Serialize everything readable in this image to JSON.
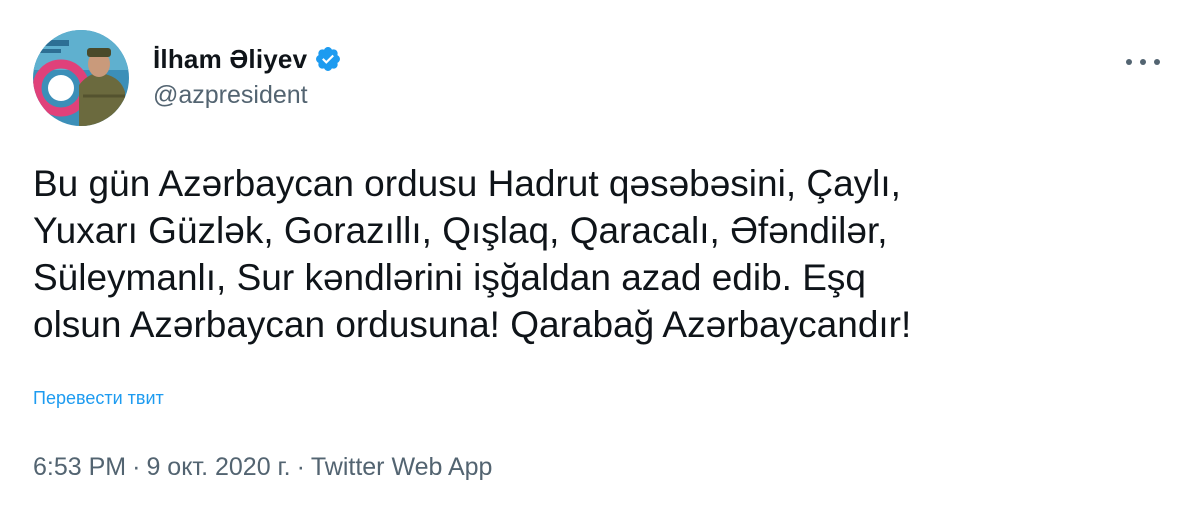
{
  "tweet": {
    "author": {
      "display_name": "İlham Əliyev",
      "handle": "@azpresident",
      "verified": true,
      "avatar_icon": "profile-photo-icon",
      "verified_icon": "verified-badge-icon"
    },
    "more_icon": "more-options-icon",
    "text_lines": [
      "Bu gün Azərbaycan ordusu Hadrut qəsəbəsini, Çaylı,",
      "Yuxarı Güzlək, Gorazıllı, Qışlaq, Qaracalı, Əfəndilər,",
      "Süleymanlı, Sur kəndlərini işğaldan azad edib. Eşq",
      "olsun Azərbaycan ordusuna! Qarabağ Azərbaycandır!"
    ],
    "translate_link": "Перевести твит",
    "time": "6:53 PM",
    "date": "9 окт. 2020 г.",
    "separator": "·",
    "source": "Twitter Web App"
  },
  "colors": {
    "text": "#0f1419",
    "secondary": "#536471",
    "link": "#1d9bf0",
    "verified": "#1d9bf0"
  }
}
